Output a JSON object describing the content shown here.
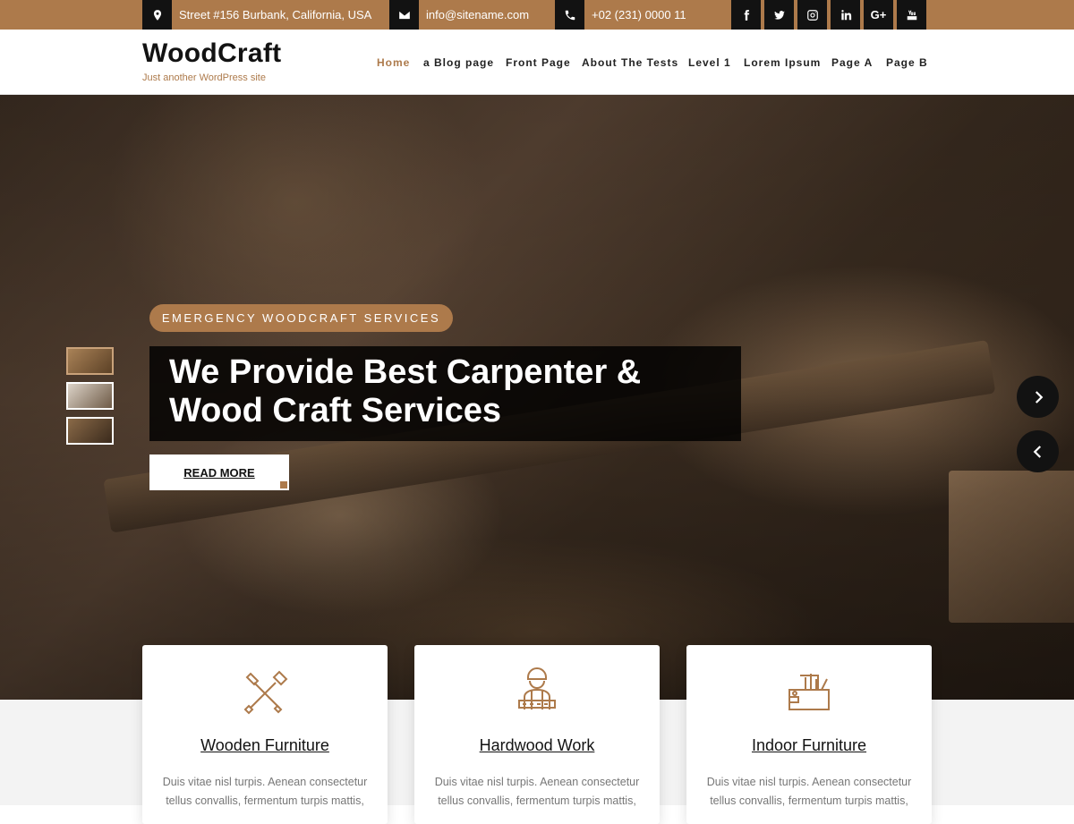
{
  "topbar": {
    "address": "Street #156 Burbank, California, USA",
    "email": "info@sitename.com",
    "phone": "+02 (231) 0000 11",
    "address_icon": "map-pin-icon",
    "email_icon": "envelope-icon",
    "phone_icon": "phone-icon",
    "social": [
      {
        "name": "facebook-icon",
        "glyph": "f"
      },
      {
        "name": "twitter-icon",
        "glyph": "t"
      },
      {
        "name": "instagram-icon",
        "glyph": "ig"
      },
      {
        "name": "linkedin-icon",
        "glyph": "in"
      },
      {
        "name": "google-plus-icon",
        "glyph": "G+"
      },
      {
        "name": "youtube-icon",
        "glyph": "yt"
      }
    ]
  },
  "header": {
    "site_title": "WoodCraft",
    "tagline": "Just another WordPress site",
    "nav": [
      "Home",
      "a Blog page",
      "Front Page",
      "About The Tests",
      "Level 1",
      "Lorem Ipsum",
      "Page A",
      "Page B"
    ],
    "active_index": 0
  },
  "hero": {
    "tag": "EMERGENCY WOODCRAFT SERVICES",
    "title_line1": "We Provide Best Carpenter &",
    "title_line2": "Wood Craft Services",
    "cta": "READ MORE"
  },
  "cards": [
    {
      "title": "Wooden Furniture",
      "icon": "tools-icon",
      "text": "Duis vitae nisl turpis. Aenean consectetur tellus convallis, fermentum turpis mattis,"
    },
    {
      "title": "Hardwood Work",
      "icon": "worker-icon",
      "text": "Duis vitae nisl turpis. Aenean consectetur tellus convallis, fermentum turpis mattis,"
    },
    {
      "title": "Indoor Furniture",
      "icon": "toolbox-icon",
      "text": "Duis vitae nisl turpis. Aenean consectetur tellus convallis, fermentum turpis mattis,"
    }
  ],
  "colors": {
    "accent": "#ad7a4b",
    "dark": "#121212"
  }
}
